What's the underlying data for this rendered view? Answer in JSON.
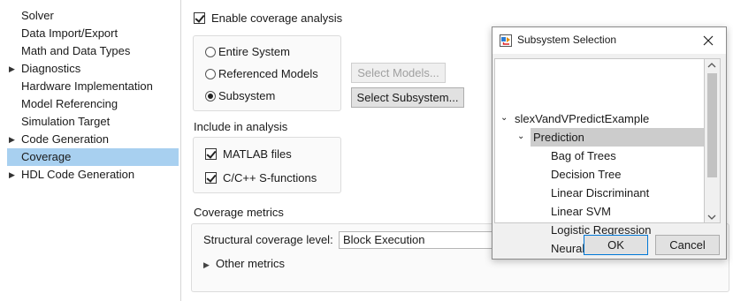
{
  "nav": {
    "items": [
      {
        "label": "Solver",
        "expandable": false,
        "selected": false
      },
      {
        "label": "Data Import/Export",
        "expandable": false,
        "selected": false
      },
      {
        "label": "Math and Data Types",
        "expandable": false,
        "selected": false
      },
      {
        "label": "Diagnostics",
        "expandable": true,
        "selected": false
      },
      {
        "label": "Hardware Implementation",
        "expandable": false,
        "selected": false
      },
      {
        "label": "Model Referencing",
        "expandable": false,
        "selected": false
      },
      {
        "label": "Simulation Target",
        "expandable": false,
        "selected": false
      },
      {
        "label": "Code Generation",
        "expandable": true,
        "selected": false
      },
      {
        "label": "Coverage",
        "expandable": false,
        "selected": true
      },
      {
        "label": "HDL Code Generation",
        "expandable": true,
        "selected": false
      }
    ]
  },
  "coverage": {
    "enable_label": "Enable coverage analysis",
    "scope": {
      "entire_system": "Entire System",
      "referenced_models": "Referenced Models",
      "subsystem": "Subsystem",
      "selected": "subsystem"
    },
    "select_models_button": "Select Models...",
    "select_subsystem_button": "Select Subsystem...",
    "include_heading": "Include in analysis",
    "matlab_files": "MATLAB files",
    "sfunctions": "C/C++ S-functions",
    "metrics_heading": "Coverage metrics",
    "structural_label": "Structural coverage level:",
    "structural_value": "Block Execution",
    "other_metrics": "Other metrics"
  },
  "dialog": {
    "title": "Subsystem Selection",
    "tree": {
      "root": "slexVandVPredictExample",
      "child": "Prediction",
      "leaves": [
        "Bag of Trees",
        "Decision Tree",
        "Linear Discriminant",
        "Linear SVM",
        "Logistic Regression",
        "Neural Network"
      ]
    },
    "ok": "OK",
    "cancel": "Cancel"
  },
  "colors": {
    "selection": "#a8d0f0",
    "tree_highlight": "#cccccc"
  }
}
